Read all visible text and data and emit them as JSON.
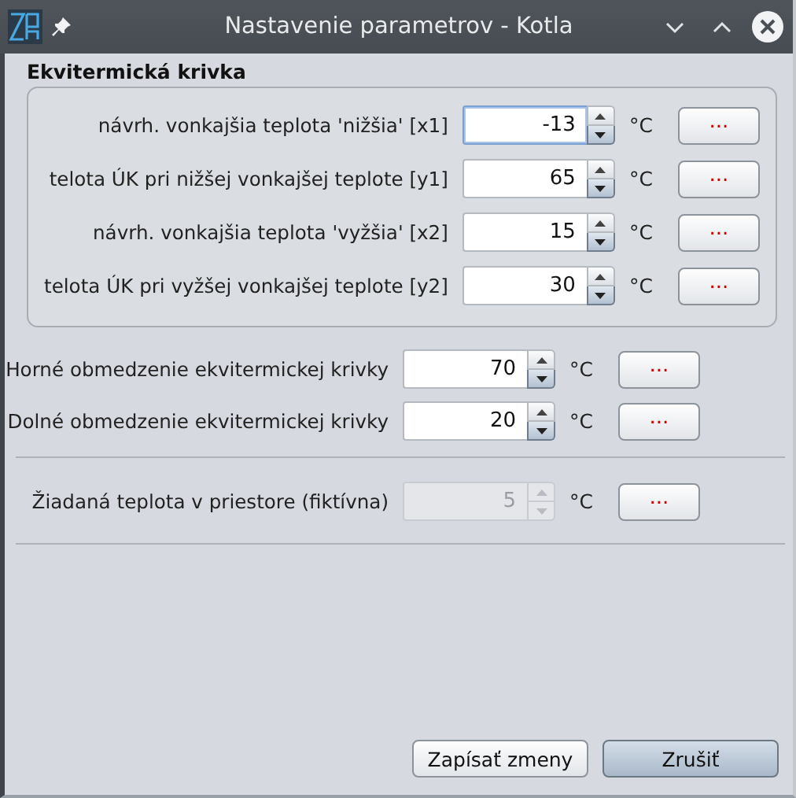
{
  "window": {
    "title": "Nastavenie parametrov - Kotla"
  },
  "curve_group": {
    "title": "Ekvitermická krivka",
    "rows": [
      {
        "label": "návrh. vonkajšia teplota 'nižšia' [x1]",
        "value": "-13",
        "unit": "°C",
        "button": "...",
        "focused": true,
        "disabled": false
      },
      {
        "label": "telota ÚK pri nižšej vonkajšej teplote [y1]",
        "value": "65",
        "unit": "°C",
        "button": "...",
        "focused": false,
        "disabled": false
      },
      {
        "label": "návrh. vonkajšia teplota 'vyžšia' [x2]",
        "value": "15",
        "unit": "°C",
        "button": "...",
        "focused": false,
        "disabled": false
      },
      {
        "label": "telota ÚK pri vyžšej vonkajšej teplote [y2]",
        "value": "30",
        "unit": "°C",
        "button": "...",
        "focused": false,
        "disabled": false
      }
    ]
  },
  "limits": [
    {
      "label": "Horné obmedzenie ekvitermickej krivky",
      "value": "70",
      "unit": "°C",
      "button": "...",
      "focused": false,
      "disabled": false
    },
    {
      "label": "Dolné obmedzenie ekvitermickej krivky",
      "value": "20",
      "unit": "°C",
      "button": "...",
      "focused": false,
      "disabled": false
    }
  ],
  "room": [
    {
      "label": "Žiadaná teplota v priestore (fiktívna)",
      "value": "5",
      "unit": "°C",
      "button": "...",
      "focused": false,
      "disabled": true
    }
  ],
  "buttons": [
    {
      "label": "Zapísať zmeny",
      "default": false
    },
    {
      "label": "Zrušiť",
      "default": true
    }
  ]
}
